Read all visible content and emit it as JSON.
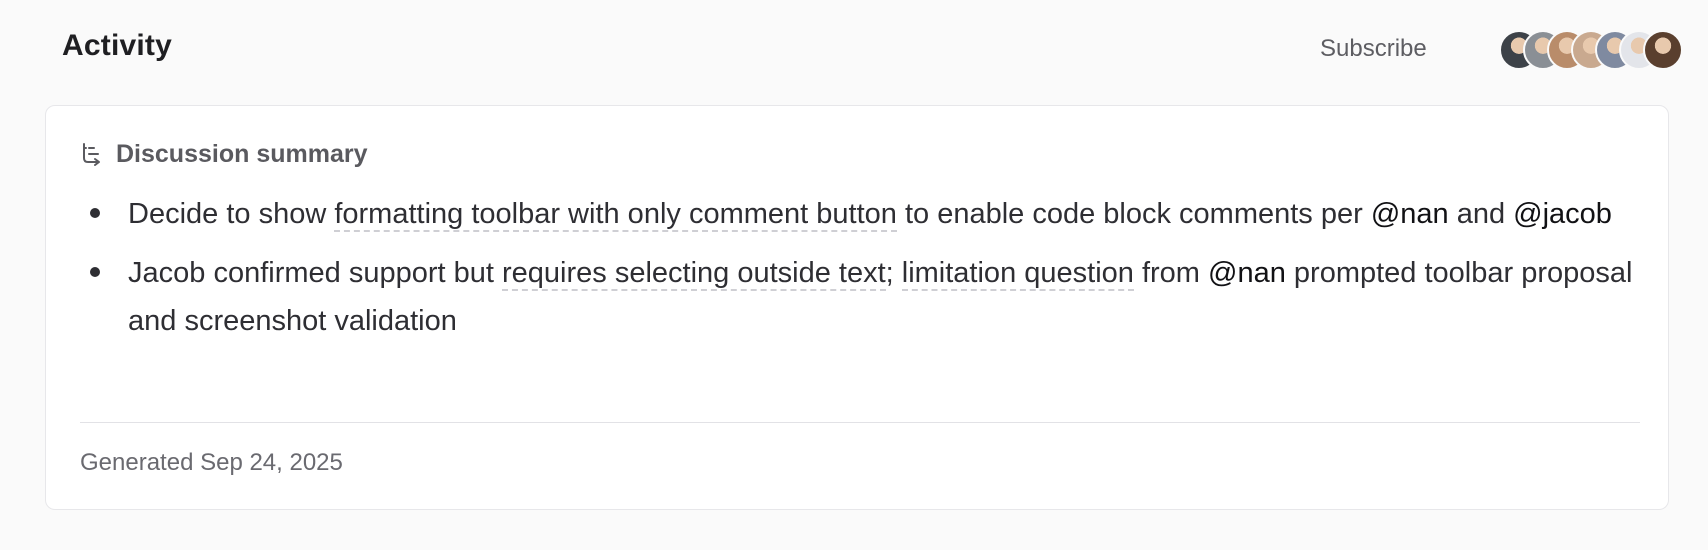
{
  "header": {
    "title": "Activity",
    "subscribe_label": "Subscribe",
    "avatars": [
      {
        "name": "avatar-1",
        "color": "#3d4248"
      },
      {
        "name": "avatar-2",
        "color": "#8a8f95"
      },
      {
        "name": "avatar-3",
        "color": "#b98c6a"
      },
      {
        "name": "avatar-4",
        "color": "#c9a98f"
      },
      {
        "name": "avatar-5",
        "color": "#7f8aa0"
      },
      {
        "name": "avatar-6",
        "color": "#e3e5ea"
      },
      {
        "name": "avatar-7",
        "color": "#5a3f2e"
      }
    ]
  },
  "summary": {
    "icon": "summary-tree-icon",
    "title": "Discussion summary",
    "bullets": [
      {
        "parts": [
          {
            "type": "text",
            "text": "Decide to show "
          },
          {
            "type": "ref",
            "text": "formatting toolbar with only comment button"
          },
          {
            "type": "text",
            "text": " to enable code block comments per "
          },
          {
            "type": "mention",
            "text": "@nan"
          },
          {
            "type": "text",
            "text": " and "
          },
          {
            "type": "mention",
            "text": "@jacob"
          }
        ]
      },
      {
        "parts": [
          {
            "type": "text",
            "text": "Jacob confirmed support but "
          },
          {
            "type": "ref",
            "text": "requires selecting outside text"
          },
          {
            "type": "text",
            "text": "; "
          },
          {
            "type": "ref",
            "text": "limitation question"
          },
          {
            "type": "text",
            "text": " from "
          },
          {
            "type": "mention",
            "text": "@nan"
          },
          {
            "type": "text",
            "text": " prompted toolbar proposal and screenshot validation"
          }
        ]
      }
    ],
    "footer": "Generated Sep 24, 2025"
  }
}
